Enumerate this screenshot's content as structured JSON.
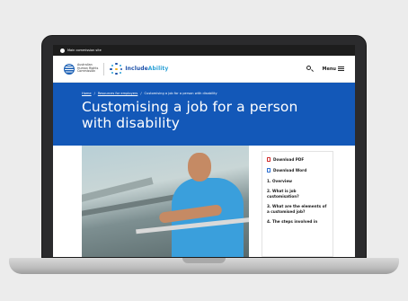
{
  "govbar": {
    "text": "Main commission site"
  },
  "header": {
    "org_name_lines": [
      "Australian",
      "Human Rights",
      "Commission"
    ],
    "brand_prefix": "Include",
    "brand_suffix": "Ability",
    "menu_label": "Menu"
  },
  "breadcrumb": {
    "items": [
      "Home",
      "Resources for employers",
      "Customising a job for a person with disability"
    ],
    "separator": "/"
  },
  "hero": {
    "title": "Customising a job for a person with disability"
  },
  "toc": {
    "download_pdf": "Download PDF",
    "download_word": "Download Word",
    "items": [
      "1. Overview",
      "2. What is job customisation?",
      "3. What are the elements of a customised job?",
      "4. The steps involved in"
    ]
  },
  "colors": {
    "hero_blue": "#1358b8",
    "brand_blue": "#1b4fa8",
    "pdf_red": "#d12b2b",
    "word_blue": "#2b6fd1"
  }
}
